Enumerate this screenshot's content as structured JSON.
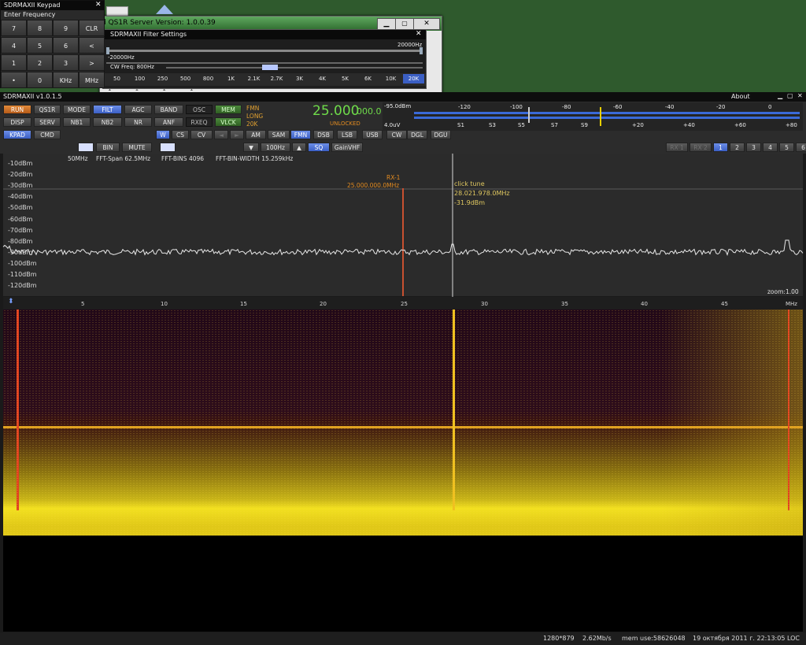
{
  "keypad": {
    "title": "SDRMAXII Keypad",
    "subtitle": "Enter Frequency",
    "close": "✕",
    "keys": [
      "7",
      "8",
      "9",
      "CLR",
      "4",
      "5",
      "6",
      "<",
      "1",
      "2",
      "3",
      ">",
      "•",
      "0",
      "KHz",
      "MHz"
    ]
  },
  "server_window": {
    "title": "d QS1R Server Version: 1.0.0.39",
    "partial_row": "1 1 1 1"
  },
  "filter_window": {
    "title": "SDRMAXII Filter Settings",
    "high": "20000Hz",
    "low": "-20000Hz",
    "cw_freq": "CW Freq: 800Hz",
    "widths": [
      "50",
      "100",
      "250",
      "500",
      "800",
      "1K",
      "2.1K",
      "2.7K",
      "3K",
      "4K",
      "5K",
      "6K",
      "10K",
      "20K"
    ],
    "selected": "20K"
  },
  "main": {
    "title": "SDRMAXII v1.0.1.5",
    "about": "About",
    "row1": [
      "RUN",
      "QS1R",
      "MODE",
      "FILT",
      "AGC",
      "BAND",
      "OSC",
      "MEM"
    ],
    "row2": [
      "DISP",
      "SERV",
      "NB1",
      "NB2",
      "NR",
      "ANF",
      "RXEQ",
      "VLCK"
    ],
    "row3": [
      "KPAD",
      "CMD"
    ],
    "mode_info": [
      "FMN",
      "LONG",
      "20K"
    ],
    "freq_main": "25.000",
    "freq_sub": "000.0",
    "lock_status": "UNLOCKED",
    "smeter": {
      "dbm": "-95.0dBm",
      "uv": "4.0uV",
      "top_scale": [
        "-120",
        "-100",
        "-80",
        "-60",
        "-40",
        "-20",
        "0"
      ],
      "bottom_scale": [
        "S1",
        "S3",
        "S5",
        "S7",
        "S9",
        "+20",
        "+40",
        "+60",
        "+80"
      ]
    },
    "sub_row": {
      "w": "W",
      "cs": "CS",
      "cv": "CV"
    },
    "modes": [
      "AM",
      "SAM",
      "FMN",
      "DSB",
      "LSB",
      "USB",
      "CW",
      "DGL",
      "DGU"
    ],
    "selected_mode": "FMN",
    "ctrl_row": {
      "bin": "BIN",
      "mute": "MUTE",
      "step": "100Hz",
      "sq": "SQ",
      "gain": "GainVHF"
    },
    "rx_tabs": [
      "RX 1",
      "RX 2"
    ],
    "num_tabs": [
      "1",
      "2",
      "3",
      "4",
      "5",
      "6"
    ],
    "selected_num": "1"
  },
  "spectrum": {
    "info": [
      "50MHz",
      "FFT-Span 62.5MHz",
      "FFT-BINS 4096",
      "FFT-BIN-WIDTH 15.259kHz"
    ],
    "y_labels": [
      "-10dBm",
      "-20dBm",
      "-30dBm",
      "-40dBm",
      "-50dBm",
      "-60dBm",
      "-70dBm",
      "-80dBm",
      "-90dBm",
      "-100dBm",
      "-110dBm",
      "-120dBm"
    ],
    "x_labels": [
      "5",
      "10",
      "15",
      "20",
      "25",
      "30",
      "35",
      "40",
      "45",
      "MHz"
    ],
    "rx_label": "RX-1",
    "rx_freq": "25.000.000.0MHz",
    "tune_title": "click tune",
    "tune_freq": "28.021.978.0MHz",
    "tune_level": "-31.9dBm",
    "zoom": "zoom:1.00"
  },
  "status": {
    "resolution": "1280*879",
    "rate": "2.62Mb/s",
    "mem": "mem use:58626048",
    "datetime": "19 октября 2011 г. 22:13:05 LOC"
  }
}
